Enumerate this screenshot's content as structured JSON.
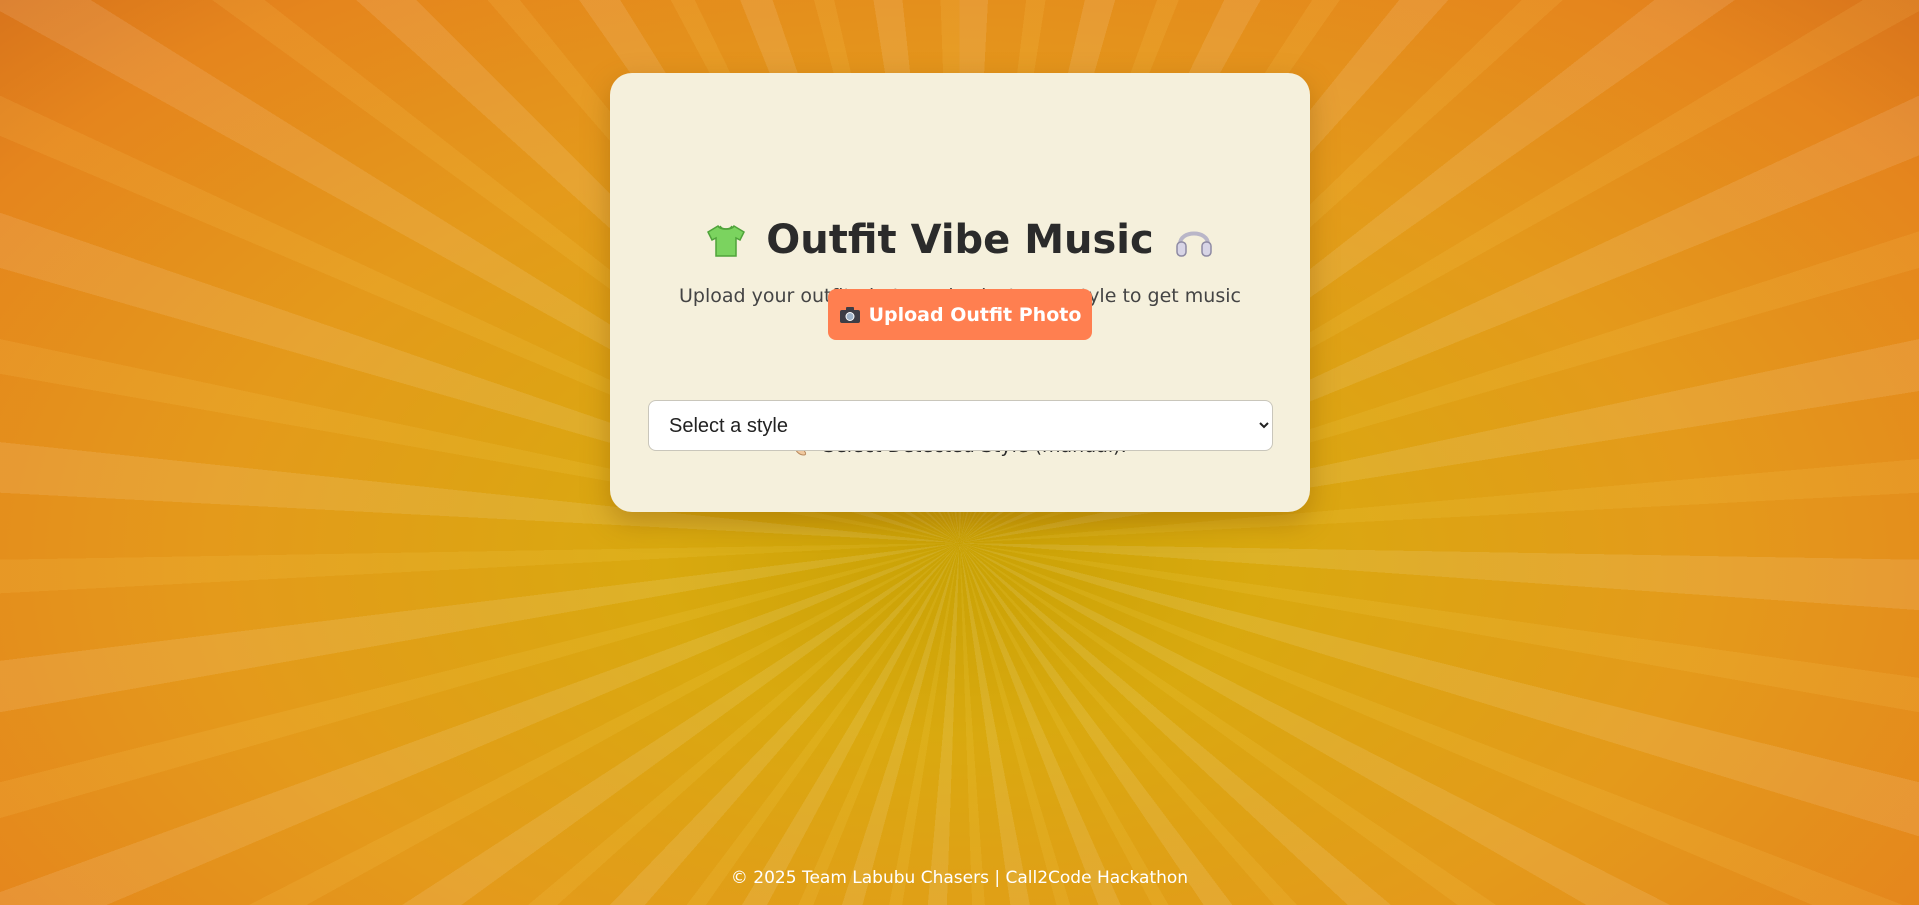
{
  "app": {
    "title": "Outfit Vibe Music",
    "subtitle": "Upload your outfit photo and select your style to get music that matches your vibe!"
  },
  "upload": {
    "label": "Upload Outfit Photo",
    "icon": "camera-icon"
  },
  "style": {
    "label": "Select Detected Style (manual):",
    "icon": "palette-icon",
    "selected": "Select a style",
    "options": [
      "Select a style"
    ]
  },
  "icons": {
    "title_left": "shirt-icon",
    "title_right": "headphones-icon"
  },
  "footer": {
    "text": "© 2025 Team Labubu Chasers | Call2Code Hackathon"
  },
  "colors": {
    "card_background": "#f5f0dc",
    "button": "#ff7f50",
    "text": "#2b2b2b",
    "background": "#e49a1b"
  }
}
